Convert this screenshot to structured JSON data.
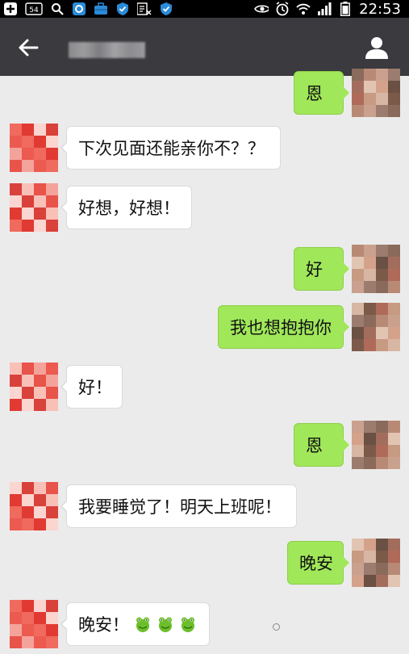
{
  "status_bar": {
    "badge": "54",
    "time": "22:53",
    "icons": [
      "plus-icon",
      "notification-badge-icon",
      "search-icon",
      "app-icon",
      "briefcase-icon",
      "shield-icon",
      "hd-icon",
      "shield-icon",
      "eye-icon",
      "alarm-icon",
      "wifi-icon",
      "signal-icon",
      "battery-icon"
    ]
  },
  "header": {
    "back_icon": "back-arrow-icon",
    "contact_name": "",
    "profile_icon": "person-icon"
  },
  "colors": {
    "incoming_bubble": "#ffffff",
    "outgoing_bubble": "#a0e75a",
    "header": "#3a3a3f",
    "background": "#ebebeb"
  },
  "messages": [
    {
      "dir": "out",
      "text": "恩"
    },
    {
      "dir": "in",
      "text": "下次见面还能亲你不？？"
    },
    {
      "dir": "in",
      "text": "好想，好想！"
    },
    {
      "dir": "out",
      "text": "好"
    },
    {
      "dir": "out",
      "text": "我也想抱抱你"
    },
    {
      "dir": "in",
      "text": "好！"
    },
    {
      "dir": "out",
      "text": "恩"
    },
    {
      "dir": "in",
      "text": "我要睡觉了！明天上班呢！"
    },
    {
      "dir": "out",
      "text": "晚安"
    },
    {
      "dir": "in",
      "text": "晚安！",
      "emojis": [
        "frog-emoji",
        "frog-emoji",
        "frog-emoji"
      ]
    }
  ]
}
